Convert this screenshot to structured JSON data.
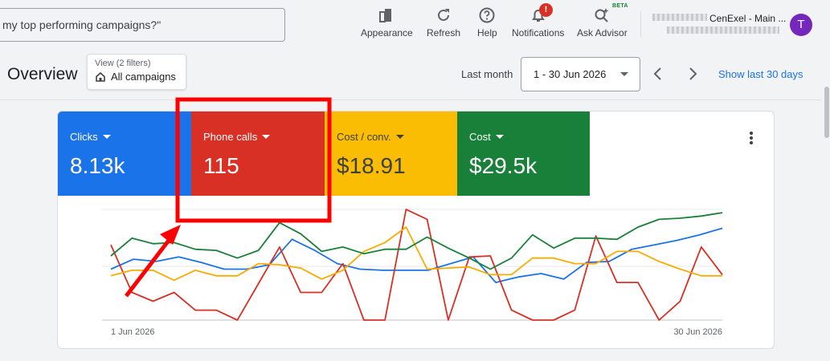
{
  "search": {
    "text": "my top performing campaigns?\""
  },
  "toolbar": {
    "appearance": "Appearance",
    "refresh": "Refresh",
    "help": "Help",
    "notifications": "Notifications",
    "notifications_badge": "!",
    "ask_advisor": "Ask Advisor",
    "beta": "BETA"
  },
  "account": {
    "name": "CenExel - Main ...",
    "avatar_letter": "T"
  },
  "overview": {
    "title": "Overview",
    "filter_sub": "View (2 filters)",
    "filter_main": "All campaigns",
    "date_label": "Last month",
    "date_range": "1 - 30 Jun 2026",
    "show_last": "Show last 30 days"
  },
  "metrics": [
    {
      "label": "Clicks",
      "value": "8.13k",
      "color": "#1a73e8"
    },
    {
      "label": "Phone calls",
      "value": "115",
      "color": "#d93025"
    },
    {
      "label": "Cost / conv.",
      "value": "$18.91",
      "color": "#fbbc04"
    },
    {
      "label": "Cost",
      "value": "$29.5k",
      "color": "#188038"
    }
  ],
  "chart_data": {
    "type": "line",
    "x_start_label": "1 Jun 2026",
    "x_end_label": "30 Jun 2026",
    "grid": true,
    "series": [
      {
        "name": "Clicks",
        "color": "#1a73e8",
        "values": [
          0.46,
          0.55,
          0.53,
          0.57,
          0.52,
          0.46,
          0.46,
          0.5,
          0.73,
          0.63,
          0.51,
          0.46,
          0.45,
          0.45,
          0.45,
          0.51,
          0.57,
          0.34,
          0.39,
          0.42,
          0.37,
          0.52,
          0.53,
          0.64,
          0.68,
          0.72,
          0.77,
          0.83
        ]
      },
      {
        "name": "Phone calls",
        "color": "#d93025",
        "values": [
          0.68,
          0.25,
          0.17,
          0.25,
          0.09,
          0.09,
          0.0,
          0.33,
          0.66,
          0.25,
          0.25,
          0.51,
          0.0,
          0.0,
          1.0,
          0.91,
          0.0,
          0.57,
          0.58,
          0.09,
          0.0,
          0.0,
          0.09,
          0.76,
          0.34,
          0.34,
          0.0,
          0.17,
          0.66,
          0.41
        ]
      },
      {
        "name": "Cost / conv.",
        "color": "#f9ab00",
        "values": [
          0.4,
          0.45,
          0.45,
          0.36,
          0.45,
          0.4,
          0.4,
          0.51,
          0.5,
          0.47,
          0.37,
          0.45,
          0.62,
          0.7,
          0.84,
          0.46,
          0.47,
          0.48,
          0.41,
          0.41,
          0.56,
          0.56,
          0.51,
          0.51,
          0.62,
          0.62,
          0.53,
          0.46,
          0.4,
          0.4
        ]
      },
      {
        "name": "Cost",
        "color": "#188038",
        "values": [
          0.58,
          0.74,
          0.69,
          0.7,
          0.64,
          0.63,
          0.56,
          0.63,
          0.88,
          0.78,
          0.62,
          0.66,
          0.6,
          0.64,
          0.64,
          0.75,
          0.65,
          0.56,
          0.46,
          0.56,
          0.77,
          0.65,
          0.74,
          0.74,
          0.73,
          0.84,
          0.91,
          0.92,
          0.94,
          0.97
        ]
      }
    ]
  },
  "annotation": {
    "box_color": "#ff0000",
    "arrow_color": "#ff0000"
  }
}
